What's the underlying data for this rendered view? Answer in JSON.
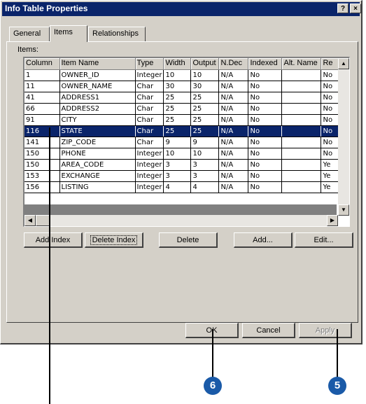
{
  "window": {
    "title": "Info Table Properties",
    "help_glyph": "?",
    "close_glyph": "×"
  },
  "tabs": [
    {
      "label": "General"
    },
    {
      "label": "Items"
    },
    {
      "label": "Relationships"
    }
  ],
  "items_label": "Items:",
  "table": {
    "columns": [
      "Column",
      "Item Name",
      "Type",
      "Width",
      "Output",
      "N.Dec",
      "Indexed",
      "Alt. Name",
      "Re"
    ],
    "rows": [
      [
        "1",
        "OWNER_ID",
        "Integer",
        "10",
        "10",
        "N/A",
        "No",
        "",
        "No"
      ],
      [
        "11",
        "OWNER_NAME",
        "Char",
        "30",
        "30",
        "N/A",
        "No",
        "",
        "No"
      ],
      [
        "41",
        "ADDRESS1",
        "Char",
        "25",
        "25",
        "N/A",
        "No",
        "",
        "No"
      ],
      [
        "66",
        "ADDRESS2",
        "Char",
        "25",
        "25",
        "N/A",
        "No",
        "",
        "No"
      ],
      [
        "91",
        "CITY",
        "Char",
        "25",
        "25",
        "N/A",
        "No",
        "",
        "No"
      ],
      [
        "116",
        "STATE",
        "Char",
        "25",
        "25",
        "N/A",
        "No",
        "",
        "No"
      ],
      [
        "141",
        "ZIP_CODE",
        "Char",
        "9",
        "9",
        "N/A",
        "No",
        "",
        "No"
      ],
      [
        "150",
        "PHONE",
        "Integer",
        "10",
        "10",
        "N/A",
        "No",
        "",
        "No"
      ],
      [
        "150",
        "AREA_CODE",
        "Integer",
        "3",
        "3",
        "N/A",
        "No",
        "",
        "Ye"
      ],
      [
        "153",
        "EXCHANGE",
        "Integer",
        "3",
        "3",
        "N/A",
        "No",
        "",
        "Ye"
      ],
      [
        "156",
        "LISTING",
        "Integer",
        "4",
        "4",
        "N/A",
        "No",
        "",
        "Ye"
      ]
    ],
    "selected_row": 5
  },
  "buttons": {
    "add_index": "Add Index",
    "delete_index": "Delete Index",
    "delete": "Delete",
    "add": "Add...",
    "edit": "Edit...",
    "ok": "OK",
    "cancel": "Cancel",
    "apply": "Apply"
  },
  "callouts": {
    "ok_step": "6",
    "apply_step": "5"
  },
  "colors": {
    "selection": "#0a246a",
    "callout": "#1a5aa8",
    "face": "#d4d0c8"
  }
}
